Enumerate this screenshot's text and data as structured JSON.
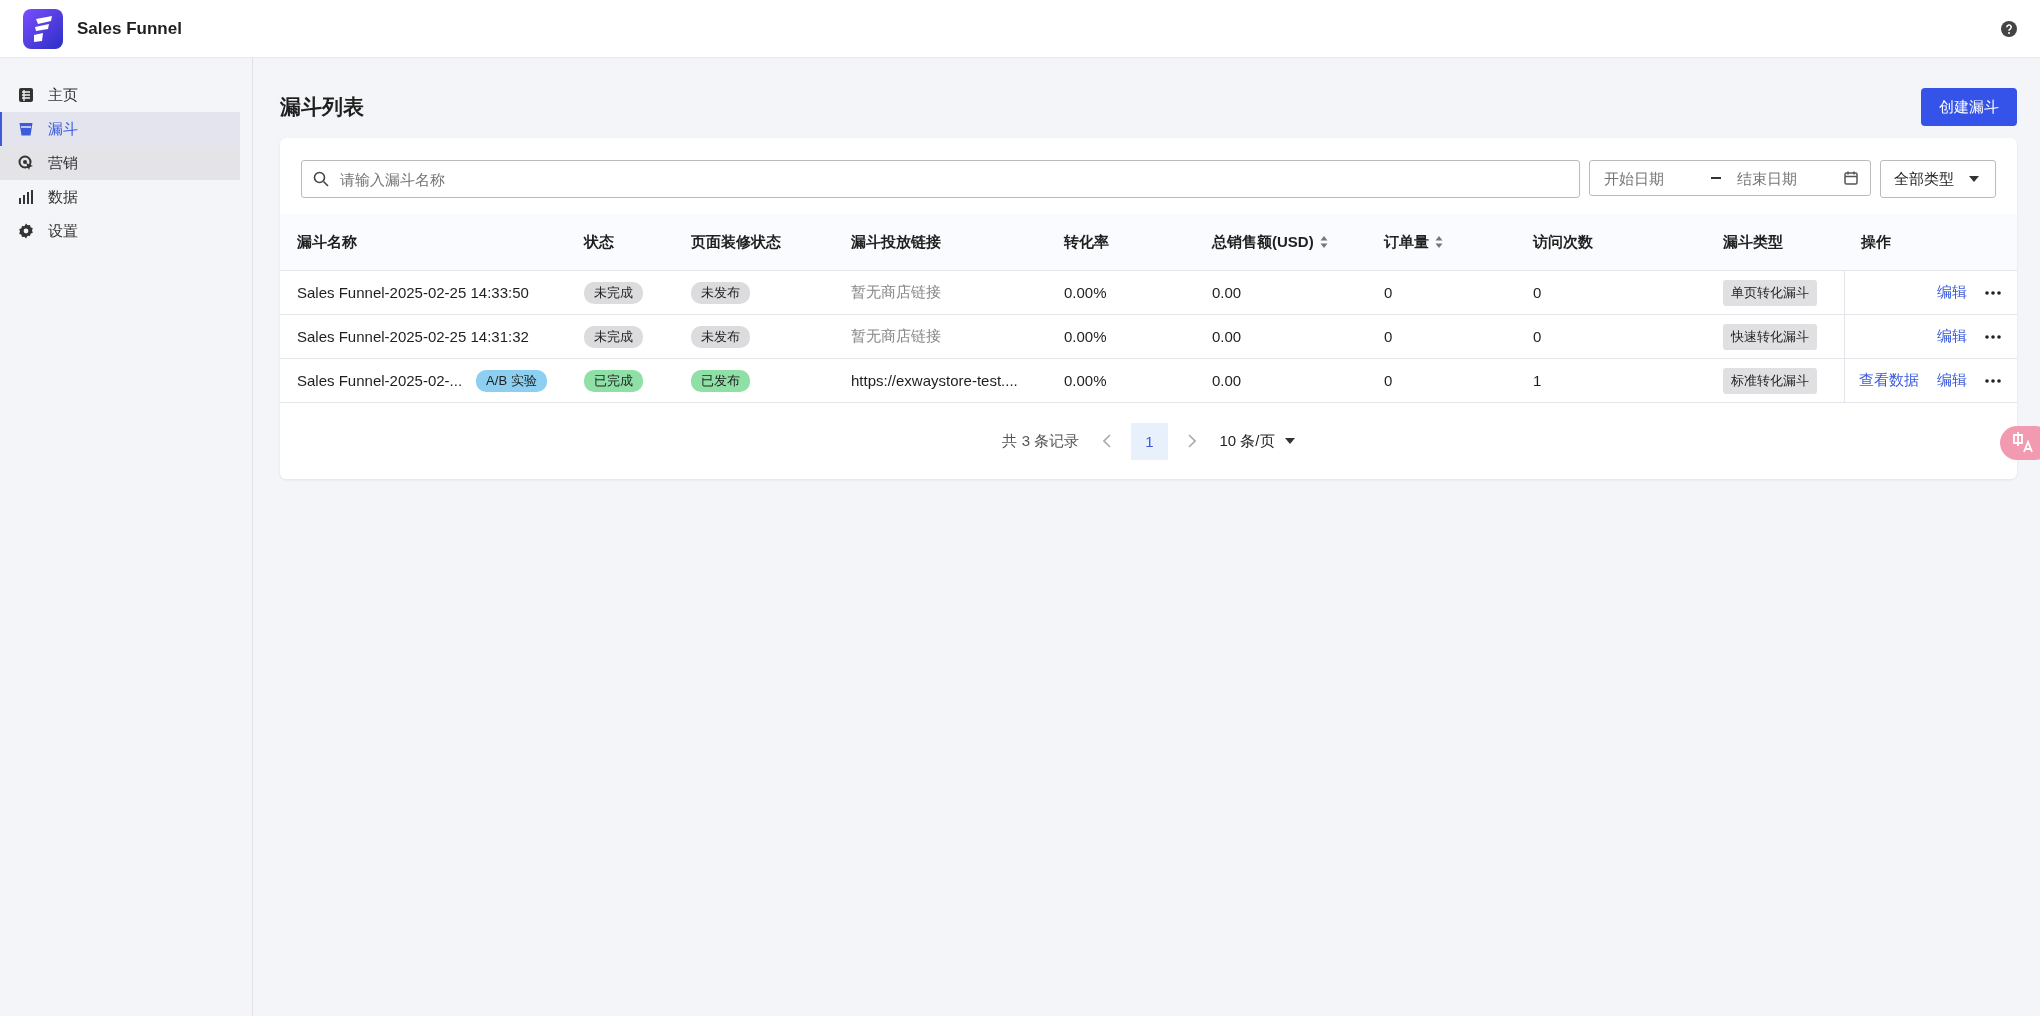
{
  "app": {
    "title": "Sales Funnel"
  },
  "sidebar": {
    "items": [
      {
        "label": "主页",
        "kind": "home",
        "selected": false,
        "hovered": false
      },
      {
        "label": "漏斗",
        "kind": "funnel",
        "selected": true,
        "hovered": false
      },
      {
        "label": "营销",
        "kind": "marketing",
        "selected": false,
        "hovered": true
      },
      {
        "label": "数据",
        "kind": "data",
        "selected": false,
        "hovered": false
      },
      {
        "label": "设置",
        "kind": "settings",
        "selected": false,
        "hovered": false
      }
    ]
  },
  "page": {
    "title": "漏斗列表",
    "create_button": "创建漏斗"
  },
  "filters": {
    "search": {
      "placeholder": "请输入漏斗名称"
    },
    "start_date": {
      "placeholder": "开始日期"
    },
    "end_date": {
      "placeholder": "结束日期"
    },
    "type_select": {
      "value": "全部类型"
    }
  },
  "table": {
    "columns": [
      {
        "label": "漏斗名称",
        "sortable": false
      },
      {
        "label": "状态",
        "sortable": false
      },
      {
        "label": "页面装修状态",
        "sortable": false
      },
      {
        "label": "漏斗投放链接",
        "sortable": false
      },
      {
        "label": "转化率",
        "sortable": false
      },
      {
        "label": "总销售额(USD)",
        "sortable": true
      },
      {
        "label": "订单量",
        "sortable": true
      },
      {
        "label": "访问次数",
        "sortable": false
      },
      {
        "label": "漏斗类型",
        "sortable": false
      },
      {
        "label": "操作",
        "sortable": false
      }
    ],
    "rows": [
      {
        "name": "Sales Funnel-2025-02-25 14:33:50",
        "badge": "",
        "status": {
          "label": "未完成",
          "done": false
        },
        "page_status": {
          "label": "未发布",
          "done": false
        },
        "link": {
          "text": "暂无商店链接",
          "kind": "placeholder"
        },
        "rate": "0.00%",
        "sales": "0.00",
        "orders": "0",
        "visits": "0",
        "type": "单页转化漏斗",
        "actions": [
          "编辑"
        ]
      },
      {
        "name": "Sales Funnel-2025-02-25 14:31:32",
        "badge": "",
        "status": {
          "label": "未完成",
          "done": false
        },
        "page_status": {
          "label": "未发布",
          "done": false
        },
        "link": {
          "text": "暂无商店链接",
          "kind": "placeholder"
        },
        "rate": "0.00%",
        "sales": "0.00",
        "orders": "0",
        "visits": "0",
        "type": "快速转化漏斗",
        "actions": [
          "编辑"
        ]
      },
      {
        "name": "Sales Funnel-2025-02-...",
        "badge": "A/B 实验",
        "status": {
          "label": "已完成",
          "done": true
        },
        "page_status": {
          "label": "已发布",
          "done": true
        },
        "link": {
          "text": "https://exwaystore-test....",
          "kind": "url"
        },
        "rate": "0.00%",
        "sales": "0.00",
        "orders": "0",
        "visits": "1",
        "type": "标准转化漏斗",
        "actions": [
          "查看数据",
          "编辑"
        ]
      }
    ]
  },
  "pagination": {
    "total": "共 3 条记录",
    "pages": [
      {
        "label": "1",
        "selected": true
      }
    ],
    "page_size": "10 条/页"
  }
}
